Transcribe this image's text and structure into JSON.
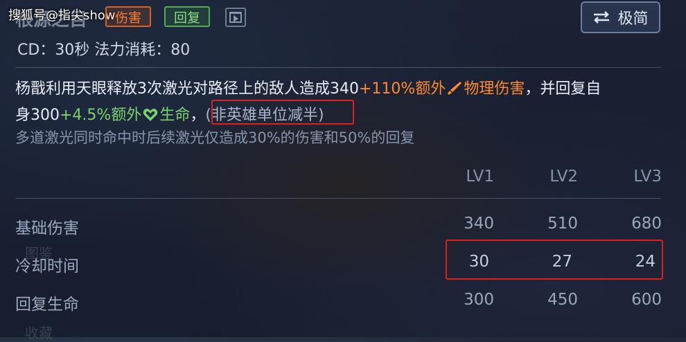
{
  "watermark": "搜狐号@指尖show",
  "skill": {
    "title": "根源之目",
    "tag_damage": "伤害",
    "tag_heal": "回复",
    "cd_line": "CD：30秒  法力消耗：80"
  },
  "toolbar": {
    "simple_label": "极简"
  },
  "description": {
    "p1_a": "杨戬利用天眼释放3次激光对路径上的敌人造成340",
    "p1_b": "+110%额外",
    "p1_c": "物理伤害",
    "p1_d": "，并回复自",
    "p2_a": "身300",
    "p2_b": "+4.5%额外",
    "p2_c": "生命",
    "p2_d": "，",
    "p2_note": "(非英雄单位减半)",
    "sub": "多道激光同时命中时后续激光仅造成30%的伤害和50%的回复"
  },
  "levels": [
    "LV1",
    "LV2",
    "LV3"
  ],
  "rows": [
    {
      "label": "基础伤害",
      "values": [
        "340",
        "510",
        "680"
      ]
    },
    {
      "label": "冷却时间",
      "values": [
        "30",
        "27",
        "24"
      ]
    },
    {
      "label": "回复生命",
      "values": [
        "300",
        "450",
        "600"
      ]
    }
  ],
  "ghost_side_labels": [
    "图鉴",
    "收藏"
  ],
  "colors": {
    "damage": "#ff8a2e",
    "heal": "#7ad46d",
    "highlight_box": "#e02020"
  }
}
